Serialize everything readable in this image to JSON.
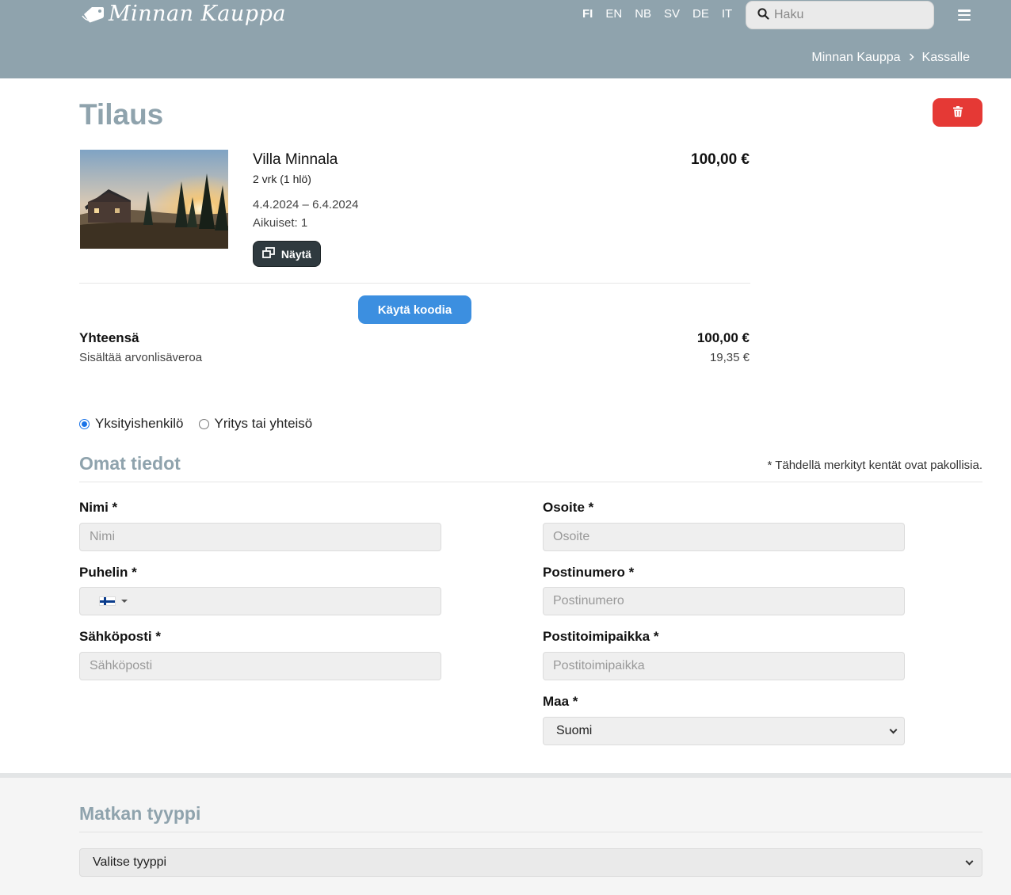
{
  "header": {
    "logo_text": "Minnan Kauppa",
    "languages": [
      {
        "code": "FI",
        "active": true
      },
      {
        "code": "EN",
        "active": false
      },
      {
        "code": "NB",
        "active": false
      },
      {
        "code": "SV",
        "active": false
      },
      {
        "code": "DE",
        "active": false
      },
      {
        "code": "IT",
        "active": false
      }
    ],
    "search_placeholder": "Haku",
    "breadcrumb": [
      "Minnan Kauppa",
      "Kassalle"
    ],
    "color": "#8fa3ad"
  },
  "order": {
    "title": "Tilaus",
    "delete_icon": "trash-icon",
    "item": {
      "name": "Villa Minnala",
      "subtitle": "2 vrk (1 hlö)",
      "dates": "4.4.2024 – 6.4.2024",
      "adults": "Aikuiset: 1",
      "price": "100,00 €",
      "show_label": "Näytä"
    },
    "code_button_label": "Käytä koodia",
    "total_label": "Yhteensä",
    "total_value": "100,00 €",
    "vat_label": "Sisältää arvonlisäveroa",
    "vat_value": "19,35 €"
  },
  "customer_type": {
    "options": [
      "Yksityishenkilö",
      "Yritys tai yhteisö"
    ],
    "selected": 0
  },
  "details": {
    "title": "Omat tiedot",
    "required_note": "* Tähdellä merkityt kentät ovat pakollisia.",
    "name_label": "Nimi *",
    "name_placeholder": "Nimi",
    "phone_label": "Puhelin *",
    "email_label": "Sähköposti *",
    "email_placeholder": "Sähköposti",
    "address_label": "Osoite *",
    "address_placeholder": "Osoite",
    "postcode_label": "Postinumero *",
    "postcode_placeholder": "Postinumero",
    "city_label": "Postitoimipaikka *",
    "city_placeholder": "Postitoimipaikka",
    "country_label": "Maa *",
    "country_value": "Suomi"
  },
  "trip": {
    "title": "Matkan tyyppi",
    "select_value": "Valitse tyyppi"
  },
  "colors": {
    "delete": "#e53935",
    "code_button": "#3c8fe0",
    "show_button": "#2f3a3f"
  }
}
